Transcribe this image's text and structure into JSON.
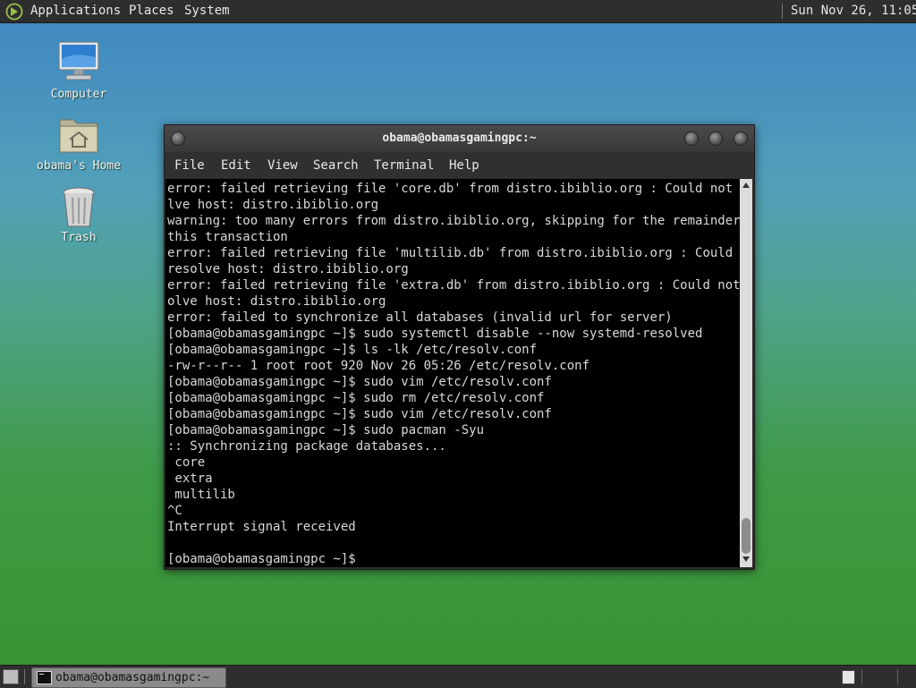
{
  "top_panel": {
    "menus": [
      "Applications",
      "Places",
      "System"
    ],
    "clock": "Sun Nov 26, 11:05"
  },
  "desktop": {
    "icons": [
      {
        "label": "Computer",
        "icon": "computer-icon"
      },
      {
        "label": "obama's Home",
        "icon": "home-folder-icon"
      },
      {
        "label": "Trash",
        "icon": "trash-icon"
      }
    ]
  },
  "window": {
    "title": "obama@obamasgamingpc:~",
    "menu": [
      "File",
      "Edit",
      "View",
      "Search",
      "Terminal",
      "Help"
    ],
    "terminal_lines": [
      "error: failed retrieving file 'core.db' from distro.ibiblio.org : Could not reso",
      "lve host: distro.ibiblio.org",
      "warning: too many errors from distro.ibiblio.org, skipping for the remainder of",
      "this transaction",
      "error: failed retrieving file 'multilib.db' from distro.ibiblio.org : Could not",
      "resolve host: distro.ibiblio.org",
      "error: failed retrieving file 'extra.db' from distro.ibiblio.org : Could not res",
      "olve host: distro.ibiblio.org",
      "error: failed to synchronize all databases (invalid url for server)",
      "[obama@obamasgamingpc ~]$ sudo systemctl disable --now systemd-resolved",
      "[obama@obamasgamingpc ~]$ ls -lk /etc/resolv.conf",
      "-rw-r--r-- 1 root root 920 Nov 26 05:26 /etc/resolv.conf",
      "[obama@obamasgamingpc ~]$ sudo vim /etc/resolv.conf",
      "[obama@obamasgamingpc ~]$ sudo rm /etc/resolv.conf",
      "[obama@obamasgamingpc ~]$ sudo vim /etc/resolv.conf",
      "[obama@obamasgamingpc ~]$ sudo pacman -Syu",
      ":: Synchronizing package databases...",
      " core",
      " extra",
      " multilib",
      "^C",
      "Interrupt signal received",
      "",
      "[obama@obamasgamingpc ~]$ "
    ]
  },
  "taskbar": {
    "tasks": [
      {
        "label": "obama@obamasgamingpc:~",
        "icon": "terminal-icon"
      }
    ]
  }
}
